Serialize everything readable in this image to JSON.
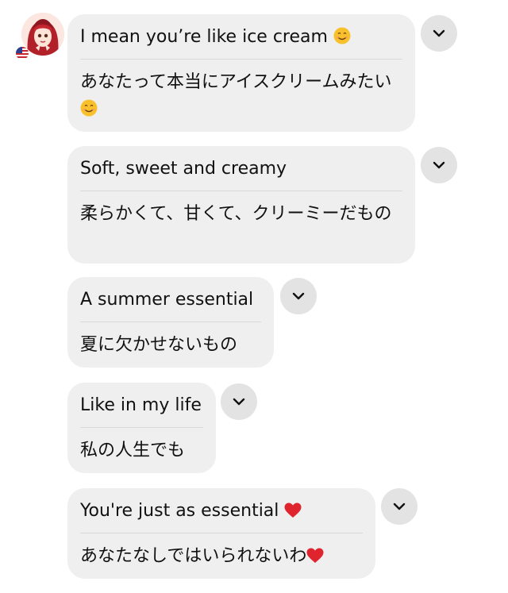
{
  "messages": [
    {
      "en": "I mean you’re like ice cream",
      "en_emoji": "smile",
      "ja": "あなたって本当にアイスクリームみたい",
      "ja_emoji": "smile"
    },
    {
      "en": "Soft, sweet and creamy",
      "ja": "柔らかくて、甘くて、クリーミーだもの"
    },
    {
      "en": "A summer essential",
      "ja": "夏に欠かせないもの"
    },
    {
      "en": "Like in my life",
      "ja": "私の人生でも"
    },
    {
      "en": "You're just as essential",
      "en_emoji": "heart",
      "ja": "あなたなしではいられないわ",
      "ja_emoji": "heart"
    }
  ],
  "icons": {
    "avatar": "avatar-icon",
    "flag": "us-flag-icon",
    "expand": "chevron-down-icon",
    "smile": "smiling-face-emoji",
    "heart": "red-heart-emoji"
  },
  "colors": {
    "bubble": "#efefef",
    "separator": "#d9d9d9",
    "chevron_button": "#e3e3e3",
    "text": "#111111",
    "heart": "#e0242e"
  }
}
